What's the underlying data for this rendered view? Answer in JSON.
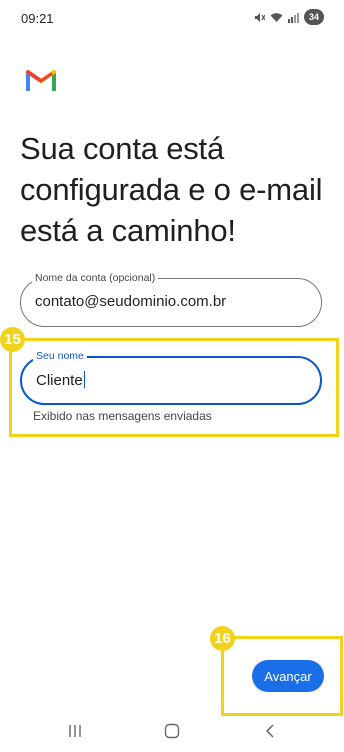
{
  "status_bar": {
    "time": "09:21",
    "battery": "34",
    "icons": [
      "mute-icon",
      "wifi-icon",
      "signal-icon",
      "battery-icon"
    ]
  },
  "brand": {
    "icon": "gmail-logo"
  },
  "heading": "Sua conta está configurada e o e-mail está a caminho!",
  "account_name_field": {
    "label": "Nome da conta (opcional)",
    "value": "contato@seudominio.com.br"
  },
  "your_name_field": {
    "label": "Seu nome",
    "value": "Cliente",
    "helper": "Exibido nas mensagens enviadas"
  },
  "annotations": [
    {
      "number": "15",
      "target": "your_name_field"
    },
    {
      "number": "16",
      "target": "next_button"
    }
  ],
  "next_button": {
    "label": "Avançar"
  },
  "nav_bar": {
    "icons": [
      "recents-icon",
      "home-icon",
      "back-icon"
    ]
  },
  "colors": {
    "accent": "#0b57d0",
    "button": "#1a6fe8",
    "highlight": "#f2d21b"
  }
}
